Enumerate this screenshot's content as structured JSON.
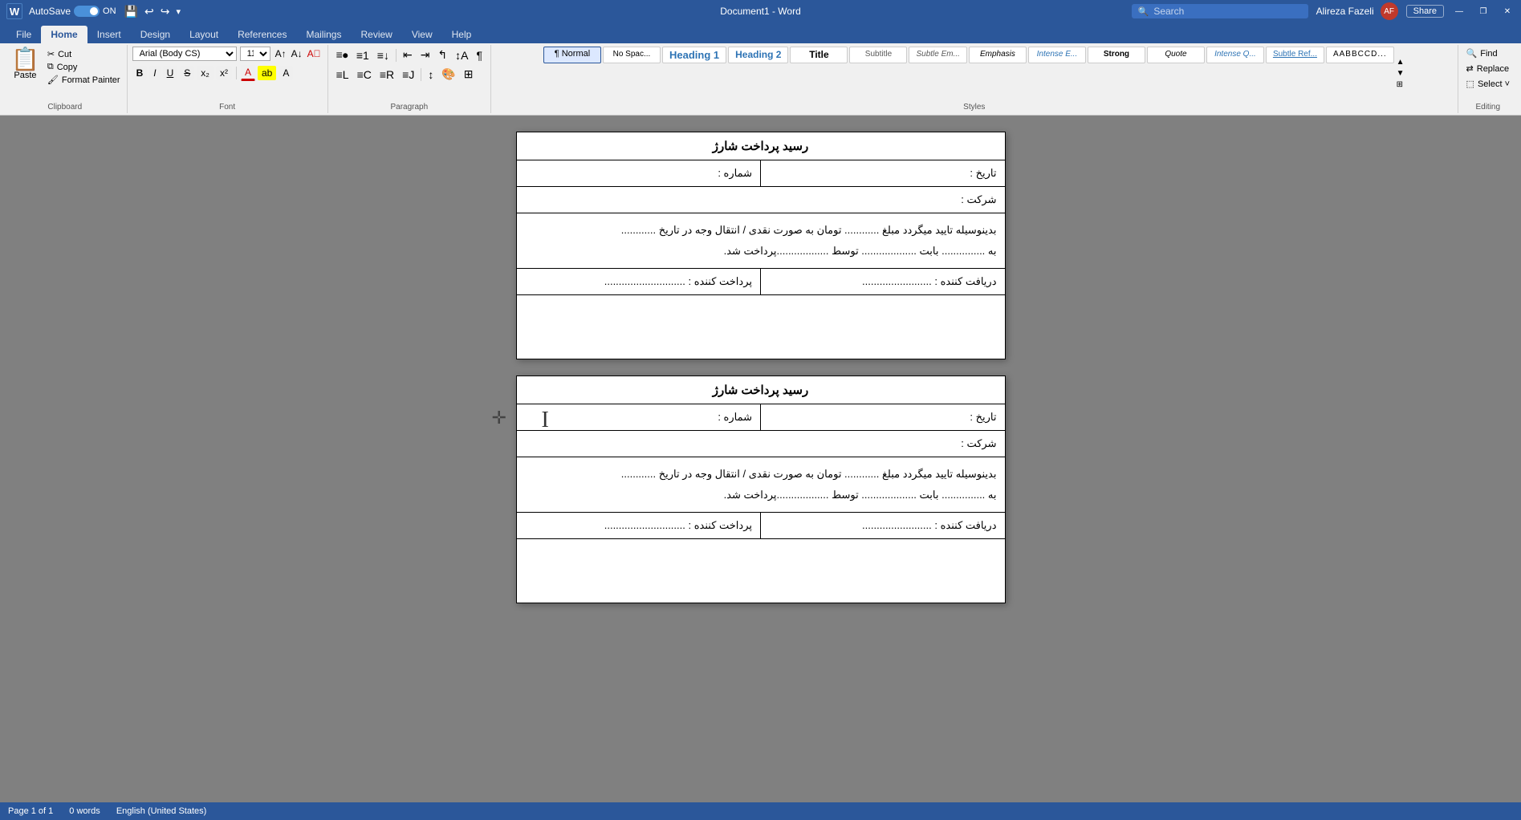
{
  "titlebar": {
    "autosave_label": "AutoSave",
    "autosave_state": "ON",
    "title": "Document1 - Word",
    "search_placeholder": "Search",
    "username": "Alireza Fazeli",
    "undo_label": "↩",
    "redo_label": "↪",
    "minimize": "—",
    "restore": "❐",
    "close": "✕"
  },
  "menu_tabs": [
    "File",
    "Home",
    "Insert",
    "Design",
    "Layout",
    "References",
    "Mailings",
    "Review",
    "View",
    "Help"
  ],
  "active_tab": "Home",
  "ribbon": {
    "clipboard": {
      "paste_label": "Paste",
      "cut_label": "Cut",
      "copy_label": "Copy",
      "format_painter_label": "Format Painter",
      "group_label": "Clipboard"
    },
    "font": {
      "font_name": "Arial (Body CS)",
      "font_size": "11",
      "bold": "B",
      "italic": "I",
      "underline": "U",
      "strikethrough": "S",
      "subscript": "x₂",
      "superscript": "x²",
      "group_label": "Font"
    },
    "paragraph": {
      "group_label": "Paragraph"
    },
    "styles": {
      "items": [
        {
          "label": "¶ Normal",
          "name": "normal",
          "active": true
        },
        {
          "label": "No Spac...",
          "name": "no-space"
        },
        {
          "label": "Heading 1",
          "name": "heading1"
        },
        {
          "label": "Heading 2",
          "name": "heading2"
        },
        {
          "label": "Title",
          "name": "title"
        },
        {
          "label": "Subtitle",
          "name": "subtitle"
        },
        {
          "label": "Subtle Em...",
          "name": "subtle-em"
        },
        {
          "label": "Emphasis",
          "name": "emphasis"
        },
        {
          "label": "Intense E...",
          "name": "intense-e"
        },
        {
          "label": "Strong",
          "name": "strong"
        },
        {
          "label": "Quote",
          "name": "quote"
        },
        {
          "label": "Intense Q...",
          "name": "intense-q"
        },
        {
          "label": "Subtle Ref...",
          "name": "subtle-ref"
        },
        {
          "label": "AABBCCD...",
          "name": "aabbccd"
        }
      ],
      "group_label": "Styles"
    },
    "editing": {
      "find_label": "Find",
      "replace_label": "Replace",
      "select_label": "Select ˅",
      "group_label": "Editing"
    }
  },
  "document": {
    "receipts": [
      {
        "title": "رسید پرداخت شارژ",
        "date_label": "تاریخ :",
        "number_label": "شماره :",
        "company_label": "شرکت :",
        "body_text": "بدینوسیله تایید میگردد مبلغ ............ تومان به صورت نقدی / انتقال وجه در تاریخ ............\nبه ............... بابت ................... توسط ..................پرداخت شد.",
        "payer_label": "پرداخت کننده :",
        "payer_dots": "............................",
        "receiver_label": "دریافت کننده :",
        "receiver_dots": "........................"
      },
      {
        "title": "رسید پرداخت شارژ",
        "date_label": "تاریخ :",
        "number_label": "شماره :",
        "company_label": "شرکت :",
        "body_text": "بدینوسیله تایید میگردد مبلغ ............ تومان به صورت نقدی / انتقال وجه در تاریخ ............\nبه ............... بابت ................... توسط ..................پرداخت شد.",
        "payer_label": "پرداخت کننده :",
        "payer_dots": "............................",
        "receiver_label": "دریافت کننده :",
        "receiver_dots": "........................"
      }
    ]
  },
  "statusbar": {
    "page_info": "Page 1 of 1",
    "word_count": "0 words",
    "language": "English (United States)"
  }
}
